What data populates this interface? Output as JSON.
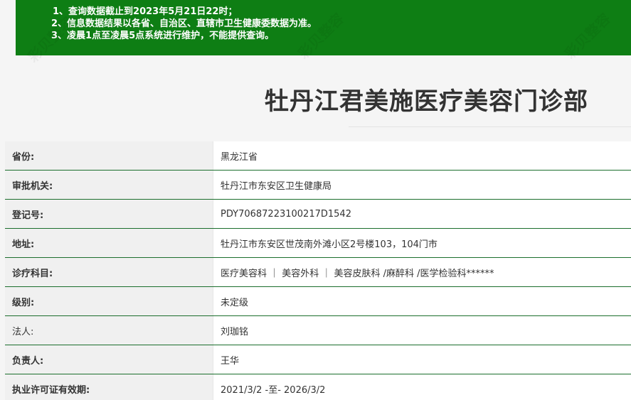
{
  "notice": {
    "lines": [
      "1、查询数据截止到2023年5月21日22时；",
      "2、信息数据结果以各省、自治区、直辖市卫生健康委数据为准。",
      "3、凌晨1点至凌晨5点系统进行维护，不能提供查询。"
    ]
  },
  "page_title": "牡丹江君美施医疗美容门诊部",
  "watermark_text": "彩贝整容",
  "rows": [
    {
      "label": "省份:",
      "value": "黑龙江省"
    },
    {
      "label": "审批机关:",
      "value": "牡丹江市东安区卫生健康局"
    },
    {
      "label": "登记号:",
      "value": "PDY70687223100217D1542"
    },
    {
      "label": "地址:",
      "value": "牡丹江市东安区世茂南外滩小区2号楼103，104门市"
    },
    {
      "label": "诊疗科目:",
      "value": "医疗美容科 ｜ 美容外科 ｜ 美容皮肤科 /麻醉科 /医学检验科******"
    },
    {
      "label": "级别:",
      "value": "未定级"
    },
    {
      "label": "法人:",
      "value": "刘珈铭"
    },
    {
      "label": "负责人:",
      "value": "王华"
    },
    {
      "label": "执业许可证有效期:",
      "value": "2021/3/2 -至- 2026/3/2"
    }
  ],
  "colors": {
    "notice_bg": "#0e7e14",
    "row_border": "#1b6e2c"
  }
}
